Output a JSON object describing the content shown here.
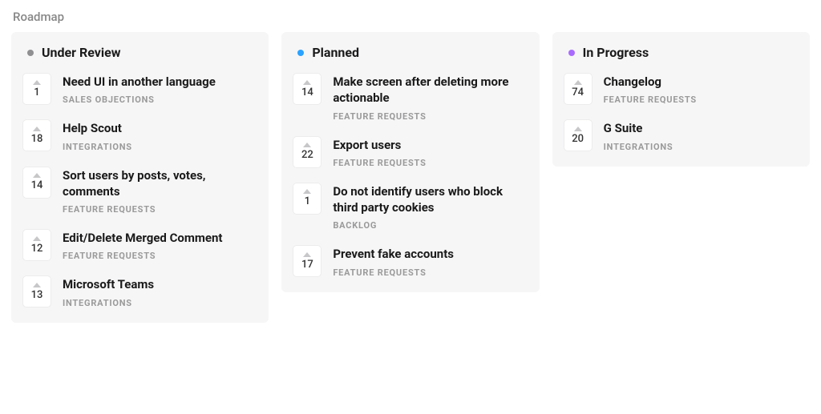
{
  "page_title": "Roadmap",
  "columns": [
    {
      "title": "Under Review",
      "dot_color": "#8f8f92",
      "cards": [
        {
          "votes": 1,
          "title": "Need UI in another language",
          "category": "SALES OBJECTIONS"
        },
        {
          "votes": 18,
          "title": "Help Scout",
          "category": "INTEGRATIONS"
        },
        {
          "votes": 14,
          "title": "Sort users by posts, votes, comments",
          "category": "FEATURE REQUESTS"
        },
        {
          "votes": 12,
          "title": "Edit/Delete Merged Comment",
          "category": "FEATURE REQUESTS"
        },
        {
          "votes": 13,
          "title": "Microsoft Teams",
          "category": "INTEGRATIONS"
        }
      ]
    },
    {
      "title": "Planned",
      "dot_color": "#2aa2ff",
      "cards": [
        {
          "votes": 14,
          "title": "Make screen after deleting more actionable",
          "category": "FEATURE REQUESTS"
        },
        {
          "votes": 22,
          "title": "Export users",
          "category": "FEATURE REQUESTS"
        },
        {
          "votes": 1,
          "title": "Do not identify users who block third party cookies",
          "category": "BACKLOG"
        },
        {
          "votes": 17,
          "title": "Prevent fake accounts",
          "category": "FEATURE REQUESTS"
        }
      ]
    },
    {
      "title": "In Progress",
      "dot_color": "#a96bff",
      "cards": [
        {
          "votes": 74,
          "title": "Changelog",
          "category": "FEATURE REQUESTS"
        },
        {
          "votes": 20,
          "title": "G Suite",
          "category": "INTEGRATIONS"
        }
      ]
    }
  ]
}
